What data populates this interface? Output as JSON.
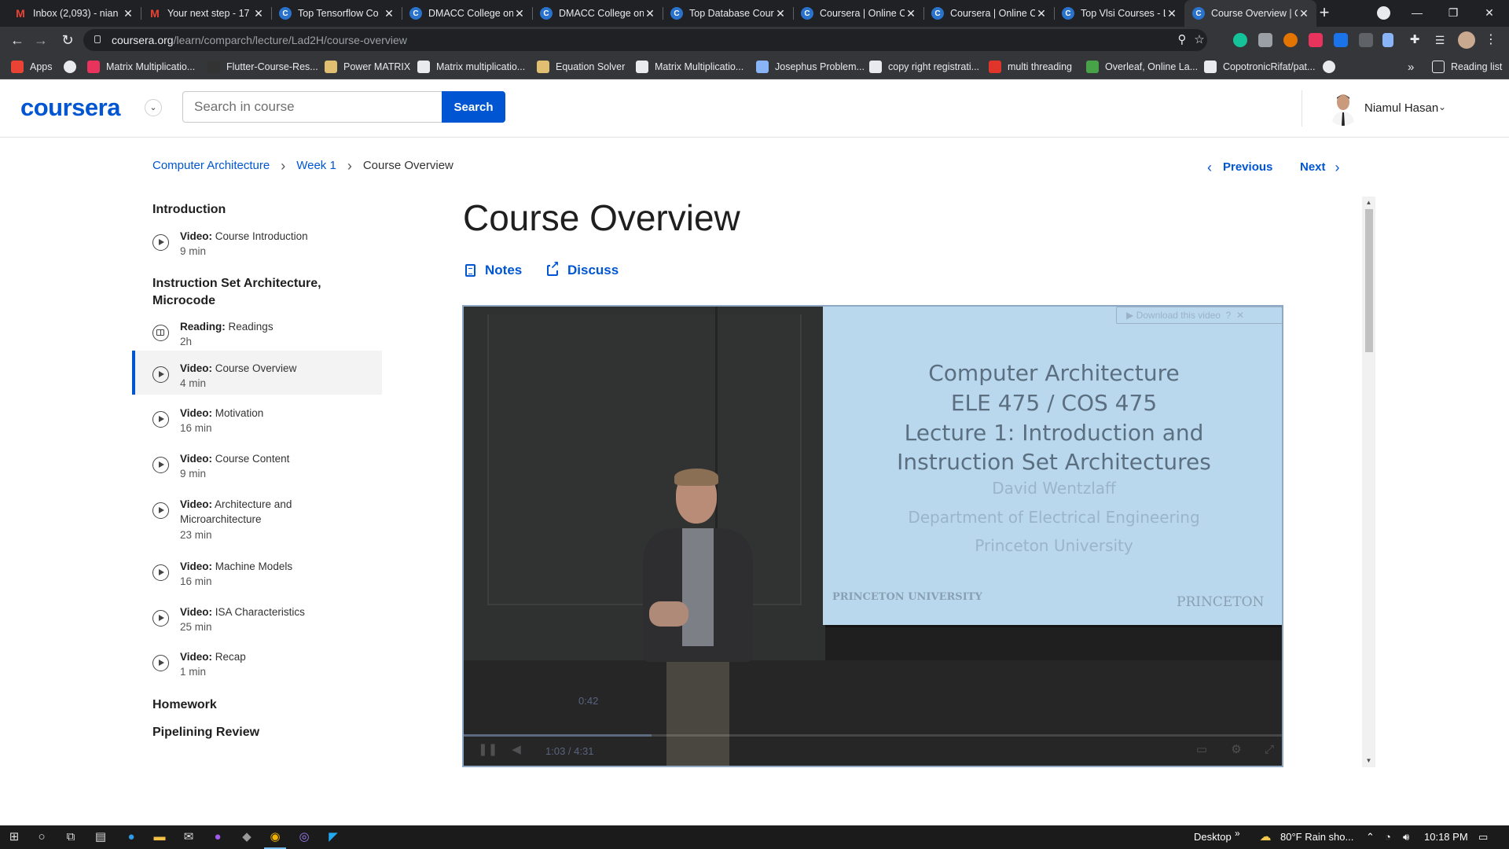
{
  "browser": {
    "tabs": [
      {
        "title": "Inbox (2,093) - nian",
        "favicon": "gmail-icon"
      },
      {
        "title": "Your next step - 17",
        "favicon": "gmail-icon"
      },
      {
        "title": "Top Tensorflow Co",
        "favicon": "coursera-icon"
      },
      {
        "title": "DMACC College on",
        "favicon": "coursera-icon"
      },
      {
        "title": "DMACC College on",
        "favicon": "coursera-icon"
      },
      {
        "title": "Top Database Cour",
        "favicon": "coursera-icon"
      },
      {
        "title": "Coursera | Online C",
        "favicon": "coursera-icon"
      },
      {
        "title": "Coursera | Online C",
        "favicon": "coursera-icon"
      },
      {
        "title": "Top Vlsi Courses - L",
        "favicon": "coursera-icon"
      },
      {
        "title": "Course Overview | C",
        "favicon": "coursera-icon",
        "active": true
      }
    ],
    "url_domain": "coursera.org",
    "url_path": "/learn/comparch/lecture/Lad2H/course-overview",
    "bookmarks": [
      "Apps",
      "",
      "Matrix Multiplicatio...",
      "Flutter-Course-Res...",
      "Power MATRIX",
      "Matrix multiplicatio...",
      "Equation Solver",
      "Matrix Multiplicatio...",
      "Josephus Problem...",
      "copy right registrati...",
      "multi threading",
      "Overleaf, Online La...",
      "CopotronicRifat/pat..."
    ],
    "reading_list": "Reading list",
    "more_bookmarks": "»"
  },
  "header": {
    "logo": "coursera",
    "search_placeholder": "Search in course",
    "search_button": "Search",
    "user_name": "Niamul Hasan"
  },
  "breadcrumb": {
    "course": "Computer Architecture",
    "week": "Week 1",
    "current": "Course Overview"
  },
  "nav": {
    "previous": "Previous",
    "next": "Next"
  },
  "sidebar": {
    "sections": [
      {
        "title": "Introduction"
      },
      {
        "title": "Instruction Set Architecture, Microcode"
      },
      {
        "title": "Homework"
      },
      {
        "title": "Pipelining Review"
      }
    ],
    "items": [
      {
        "type": "Video:",
        "name": "Course Introduction",
        "duration": "9 min"
      },
      {
        "type": "Reading:",
        "name": "Readings",
        "duration": "2h"
      },
      {
        "type": "Video:",
        "name": "Course Overview",
        "duration": "4 min",
        "active": true
      },
      {
        "type": "Video:",
        "name": "Motivation",
        "duration": "16 min"
      },
      {
        "type": "Video:",
        "name": "Course Content",
        "duration": "9 min"
      },
      {
        "type": "Video:",
        "name": "Architecture and Microarchitecture",
        "duration": "23 min"
      },
      {
        "type": "Video:",
        "name": "Machine Models",
        "duration": "16 min"
      },
      {
        "type": "Video:",
        "name": "ISA Characteristics",
        "duration": "25 min"
      },
      {
        "type": "Video:",
        "name": "Recap",
        "duration": "1 min"
      }
    ]
  },
  "main": {
    "title": "Course Overview",
    "notes": "Notes",
    "discuss": "Discuss"
  },
  "video": {
    "download_label": "Download this video",
    "slide_lines": [
      "Computer Architecture",
      "ELE 475 / COS 475",
      "Lecture 1: Introduction and",
      "Instruction Set Architectures",
      "David Wentzlaff",
      "Department of Electrical Engineering",
      "Princeton University"
    ],
    "logo_left": "PRINCETON UNIVERSITY",
    "logo_right": "PRINCETON",
    "time": "1:03 / 4:31",
    "hover_time": "0:42",
    "progress": 0.23
  },
  "taskbar": {
    "desktop": "Desktop",
    "weather": "80°F  Rain sho...",
    "clock": "10:18 PM"
  }
}
